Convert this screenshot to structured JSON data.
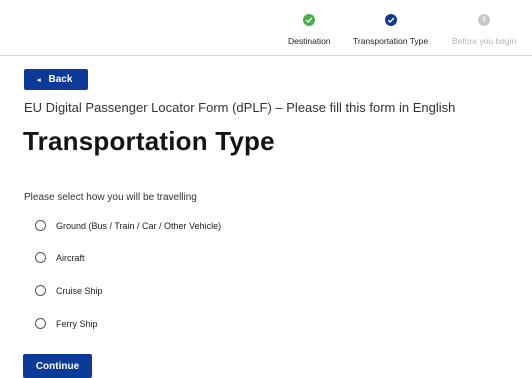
{
  "stepper": {
    "steps": [
      {
        "label": "Destination",
        "status": "complete",
        "icon": "check-icon"
      },
      {
        "label": "Transportation Type",
        "status": "current",
        "icon": "check-icon"
      },
      {
        "label": "Before you begin",
        "status": "pending",
        "number": "3"
      }
    ]
  },
  "nav": {
    "back_label": "Back",
    "back_icon": "chevron-left-icon"
  },
  "form": {
    "subtitle": "EU Digital Passenger Locator Form (dPLF) – Please fill this form in English",
    "title": "Transportation Type",
    "prompt": "Please select how you will be travelling",
    "options": [
      {
        "label": "Ground (Bus / Train / Car / Other Vehicle)",
        "selected": false
      },
      {
        "label": "Aircraft",
        "selected": false
      },
      {
        "label": "Cruise Ship",
        "selected": false
      },
      {
        "label": "Ferry Ship",
        "selected": false
      }
    ],
    "continue_label": "Continue"
  },
  "colors": {
    "primary": "#0b3a98",
    "step_complete": "#4aad4e",
    "step_current": "#0d3a8c",
    "step_pending": "#c8c8c8"
  }
}
